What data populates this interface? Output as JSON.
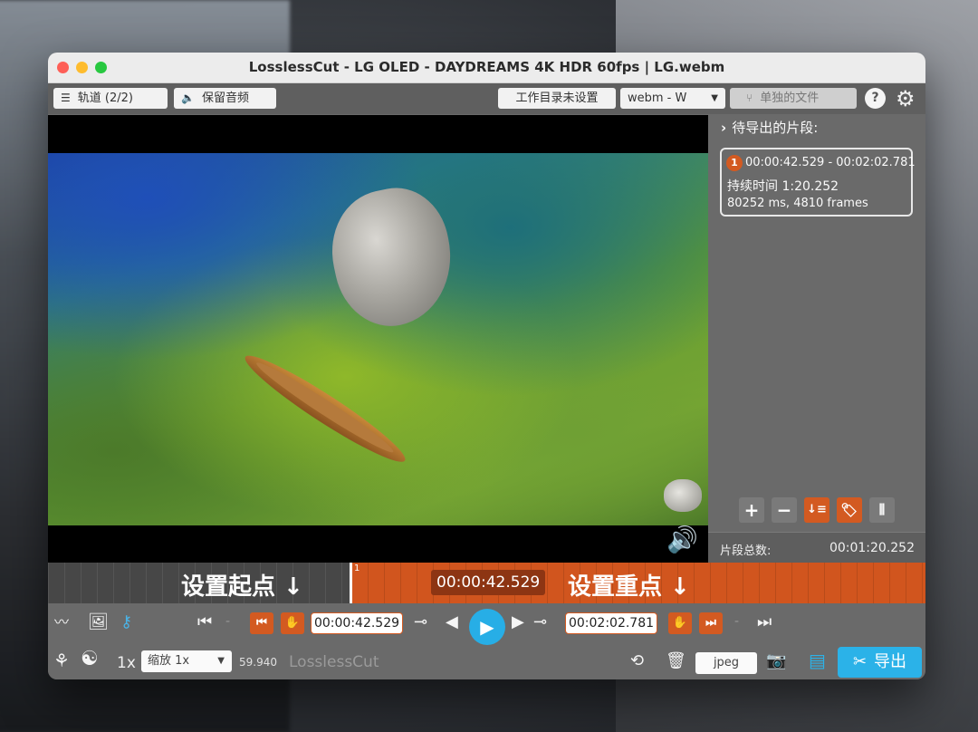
{
  "window": {
    "title": "LosslessCut - LG OLED - DAYDREAMS 4K HDR 60fps | LG.webm"
  },
  "toolbar": {
    "tracks_label": "轨道 (2/2)",
    "keep_audio_label": "保留音频",
    "workdir_label": "工作目录未设置",
    "format_label": "webm - W",
    "separate_files_label": "单独的文件",
    "help_label": "?"
  },
  "sidebar": {
    "header": "待导出的片段:",
    "segment": {
      "index": "1",
      "range": "00:00:42.529 - 00:02:02.781",
      "duration": "持续时间 1:20.252",
      "frames": "80252 ms, 4810 frames"
    },
    "total_label": "片段总数:",
    "total_value": "00:01:20.252"
  },
  "timeline": {
    "set_start_label": "设置起点 ↓",
    "set_end_label": "设置重点 ↓",
    "current_time": "00:00:42.529",
    "marker_number": "1"
  },
  "controls": {
    "start_time": "00:00:42.529",
    "end_time": "00:02:02.781",
    "playback_rate": "1x",
    "zoom_label": "缩放 1x",
    "fps": "59.940",
    "app_name": "LosslessCut",
    "capture_format": "jpeg",
    "export_label": "导出"
  },
  "colors": {
    "accent": "#d35a21",
    "play": "#27aee6",
    "export": "#2bb2e8"
  }
}
